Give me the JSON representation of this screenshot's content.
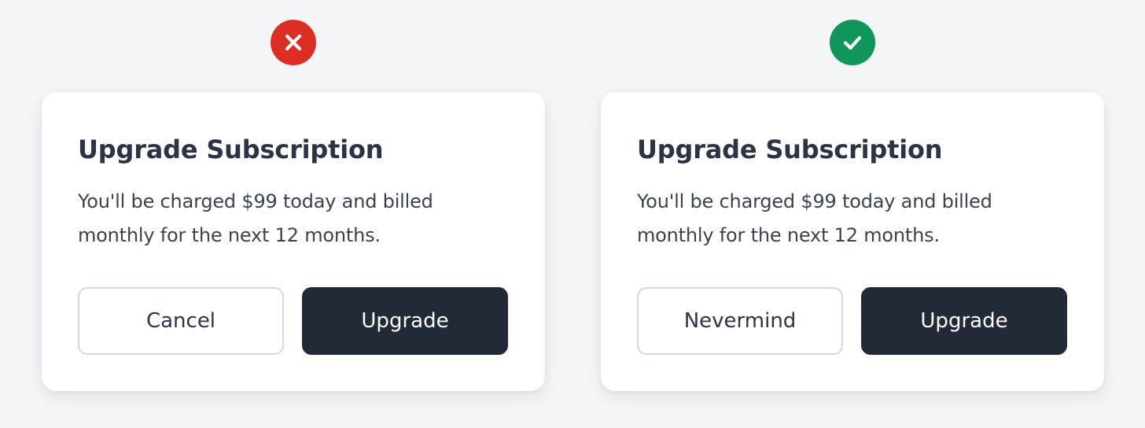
{
  "colors": {
    "page_background": "#f4f5f7",
    "bad_verdict": "#dd2e26",
    "good_verdict": "#10955a",
    "card_background": "#ffffff",
    "title_text": "#2a3446",
    "body_text": "#3a4252",
    "primary_button": "#232a37",
    "secondary_button_border": "#d3d8e0"
  },
  "examples": [
    {
      "verdict": "incorrect",
      "verdict_icon": "x-mark-icon",
      "dialog": {
        "title": "Upgrade Subscription",
        "message": "You'll be charged $99 today and billed monthly for the next 12 months.",
        "secondary_button_label": "Cancel",
        "primary_button_label": "Upgrade"
      }
    },
    {
      "verdict": "correct",
      "verdict_icon": "checkmark-icon",
      "dialog": {
        "title": "Upgrade Subscription",
        "message": "You'll be charged $99 today and billed monthly for the next 12 months.",
        "secondary_button_label": "Nevermind",
        "primary_button_label": "Upgrade"
      }
    }
  ]
}
